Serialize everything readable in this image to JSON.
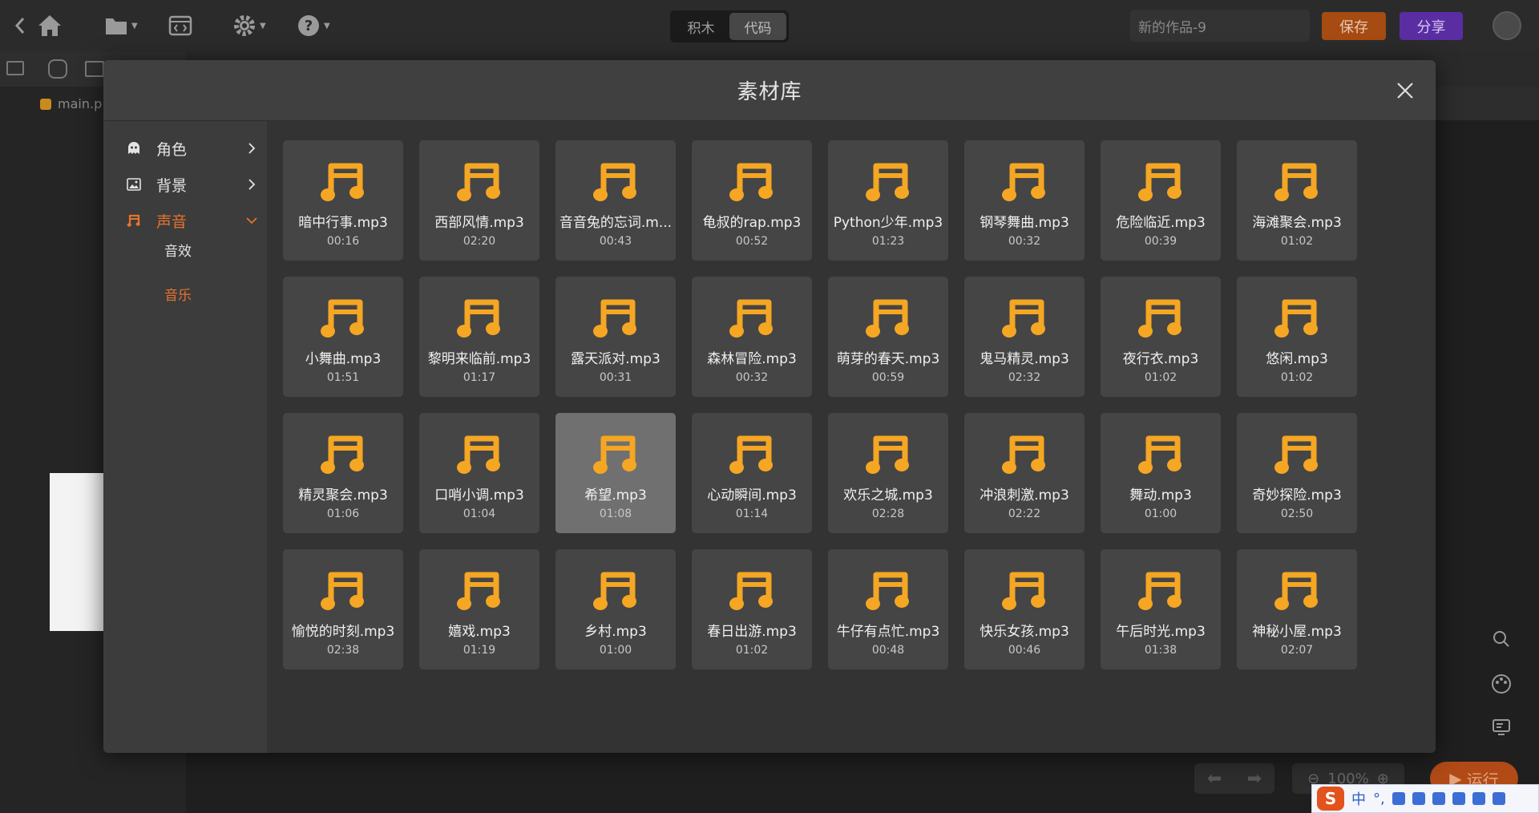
{
  "topbar": {
    "mode_blocks": "积木",
    "mode_code": "代码",
    "project_name": "新的作品-9",
    "save_label": "保存",
    "share_label": "分享"
  },
  "workspace": {
    "file_name": "main.p",
    "zoom_label": "100%",
    "run_label": "运行"
  },
  "modal": {
    "title": "素材库",
    "sidebar": {
      "items": [
        {
          "label": "角色",
          "icon": "ghost-icon"
        },
        {
          "label": "背景",
          "icon": "image-icon"
        },
        {
          "label": "声音",
          "icon": "music-note-icon",
          "active": true
        }
      ],
      "sub_items": [
        {
          "label": "音效"
        },
        {
          "label": "音乐",
          "active": true
        }
      ]
    },
    "sounds": [
      {
        "name": "暗中行事.mp3",
        "duration": "00:16"
      },
      {
        "name": "西部风情.mp3",
        "duration": "02:20"
      },
      {
        "name": "音音兔的忘词.m...",
        "duration": "00:43"
      },
      {
        "name": "龟叔的rap.mp3",
        "duration": "00:52"
      },
      {
        "name": "Python少年.mp3",
        "duration": "01:23"
      },
      {
        "name": "钢琴舞曲.mp3",
        "duration": "00:32"
      },
      {
        "name": "危险临近.mp3",
        "duration": "00:39"
      },
      {
        "name": "海滩聚会.mp3",
        "duration": "01:02"
      },
      {
        "name": "小舞曲.mp3",
        "duration": "01:51"
      },
      {
        "name": "黎明来临前.mp3",
        "duration": "01:17"
      },
      {
        "name": "露天派对.mp3",
        "duration": "00:31"
      },
      {
        "name": "森林冒险.mp3",
        "duration": "00:32"
      },
      {
        "name": "萌芽的春天.mp3",
        "duration": "00:59"
      },
      {
        "name": "鬼马精灵.mp3",
        "duration": "02:32"
      },
      {
        "name": "夜行衣.mp3",
        "duration": "01:02"
      },
      {
        "name": "悠闲.mp3",
        "duration": "01:02"
      },
      {
        "name": "精灵聚会.mp3",
        "duration": "01:06"
      },
      {
        "name": "口哨小调.mp3",
        "duration": "01:04"
      },
      {
        "name": "希望.mp3",
        "duration": "01:08",
        "selected": true
      },
      {
        "name": "心动瞬间.mp3",
        "duration": "01:14"
      },
      {
        "name": "欢乐之城.mp3",
        "duration": "02:28"
      },
      {
        "name": "冲浪刺激.mp3",
        "duration": "02:22"
      },
      {
        "name": "舞动.mp3",
        "duration": "01:00"
      },
      {
        "name": "奇妙探险.mp3",
        "duration": "02:50"
      },
      {
        "name": "愉悦的时刻.mp3",
        "duration": "02:38"
      },
      {
        "name": "嬉戏.mp3",
        "duration": "01:19"
      },
      {
        "name": "乡村.mp3",
        "duration": "01:00"
      },
      {
        "name": "春日出游.mp3",
        "duration": "01:02"
      },
      {
        "name": "牛仔有点忙.mp3",
        "duration": "00:48"
      },
      {
        "name": "快乐女孩.mp3",
        "duration": "00:46"
      },
      {
        "name": "午后时光.mp3",
        "duration": "01:38"
      },
      {
        "name": "神秘小屋.mp3",
        "duration": "02:07"
      }
    ]
  },
  "ime": {
    "logo": "S",
    "mode": "中",
    "punct": "°,"
  },
  "colors": {
    "accent_orange": "#e8722c",
    "note_yellow": "#f5a623",
    "save_bg": "#a64b12",
    "share_bg": "#5a2da3"
  }
}
